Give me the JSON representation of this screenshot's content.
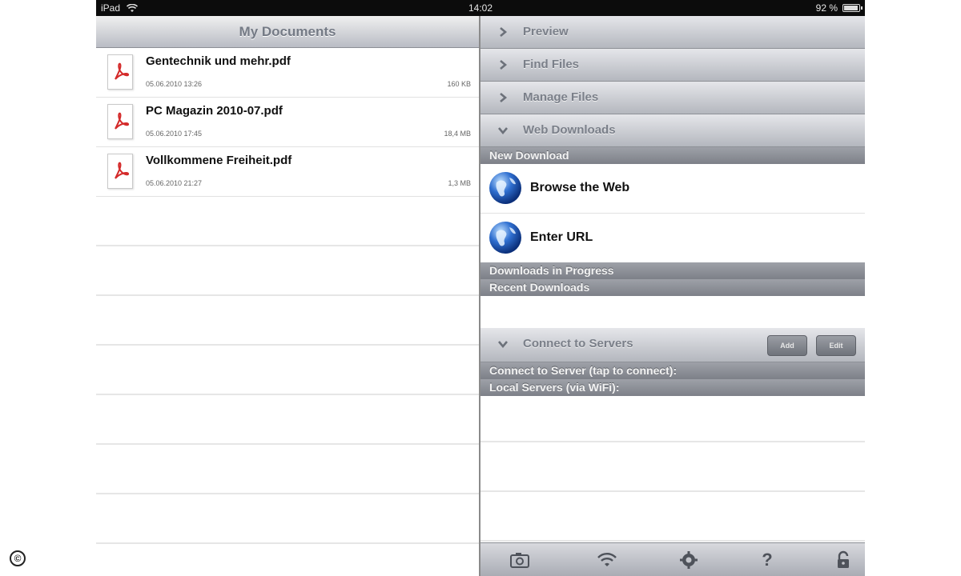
{
  "status_bar": {
    "device": "iPad",
    "time": "14:02",
    "battery": "92 %",
    "battery_level": 0.92
  },
  "left_pane": {
    "title": "My Documents",
    "documents": [
      {
        "name": "Gentechnik und mehr.pdf",
        "date": "05.06.2010 13:26",
        "size": "160 KB"
      },
      {
        "name": "PC Magazin 2010-07.pdf",
        "date": "05.06.2010 17:45",
        "size": "18,4 MB"
      },
      {
        "name": "Vollkommene Freiheit.pdf",
        "date": "05.06.2010 21:27",
        "size": "1,3 MB"
      }
    ]
  },
  "right_pane": {
    "sections": {
      "preview": "Preview",
      "find_files": "Find Files",
      "manage_files": "Manage Files",
      "web_downloads": "Web Downloads",
      "connect_to_servers": "Connect to Servers"
    },
    "web_downloads": {
      "new_download": "New Download",
      "browse_the_web": "Browse the Web",
      "enter_url": "Enter URL",
      "downloads_in_progress": "Downloads in Progress",
      "recent_downloads": "Recent Downloads"
    },
    "servers": {
      "add_button": "Add",
      "edit_button": "Edit",
      "connect_to_server": "Connect to Server (tap to connect):",
      "local_servers": "Local Servers (via WiFi):"
    },
    "toolbar_icons": [
      "camera-icon",
      "wifi-icon",
      "settings-icon",
      "help-icon",
      "lock-icon"
    ],
    "help_glyph": "?"
  },
  "watermark": "©",
  "colors": {
    "header_text": "#7a7f89",
    "group_label_bg": "#8b8e95",
    "pdf_red": "#d42a2a",
    "globe_blue": "#2f6fd0"
  }
}
